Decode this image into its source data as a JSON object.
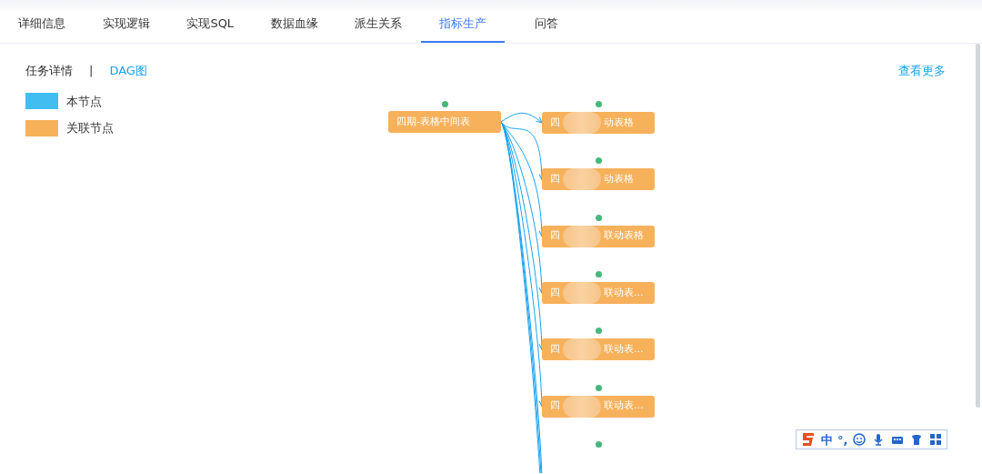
{
  "tabs": [
    {
      "label": "详细信息",
      "selected": false
    },
    {
      "label": "实现逻辑",
      "selected": false
    },
    {
      "label": "实现SQL",
      "selected": false
    },
    {
      "label": "数据血缘",
      "selected": false
    },
    {
      "label": "派生关系",
      "selected": false
    },
    {
      "label": "指标生产",
      "selected": true
    },
    {
      "label": "问答",
      "selected": false
    }
  ],
  "view_switch": [
    {
      "label": "任务详情",
      "selected": false
    },
    {
      "label": "DAG图",
      "selected": true
    }
  ],
  "view_separator": "|",
  "more_link": "查看更多",
  "legend": [
    {
      "label": "本节点",
      "color": "#41bdf1"
    },
    {
      "label": "关联节点",
      "color": "#f7b15b"
    }
  ],
  "dag": {
    "source": {
      "label": "四期-表格中间表"
    },
    "targets": [
      {
        "label_start": "四",
        "label_end": "动表格"
      },
      {
        "label_start": "四",
        "label_end": "动表格"
      },
      {
        "label_start": "四",
        "label_end": "联动表格"
      },
      {
        "label_start": "四",
        "label_end": "联动表..."
      },
      {
        "label_start": "四",
        "label_end": "联动表..."
      },
      {
        "label_start": "四",
        "label_end": "联动表..."
      }
    ]
  },
  "ime_toolbar": {
    "mode": "中",
    "punctuation": "°,"
  }
}
